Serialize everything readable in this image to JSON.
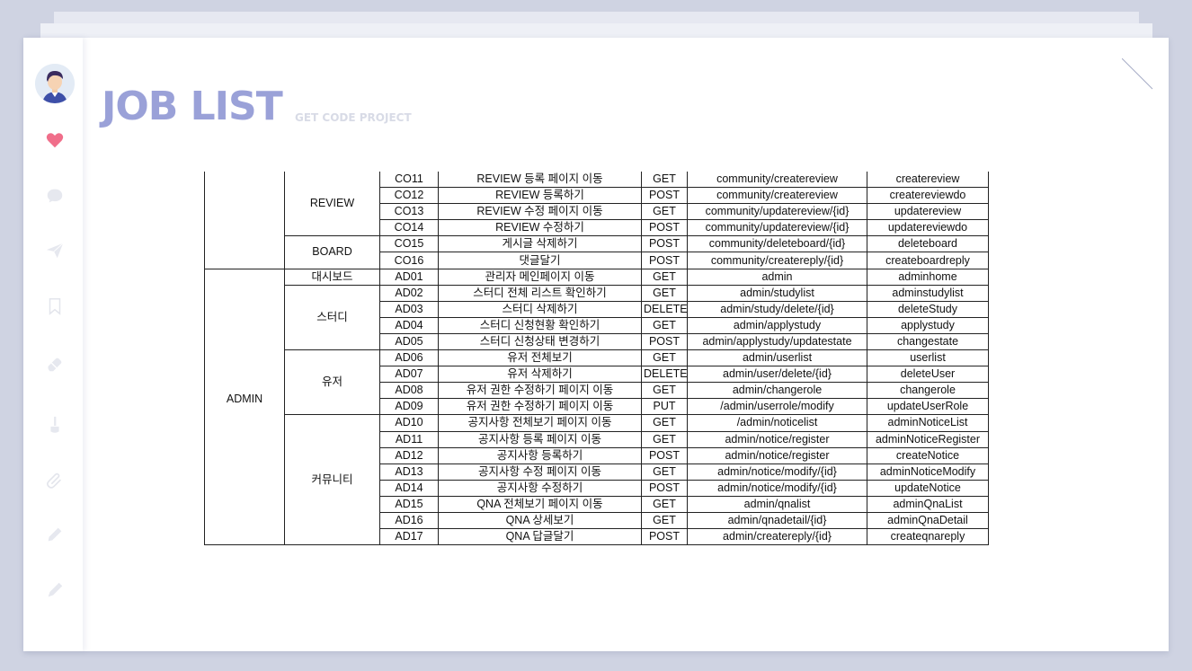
{
  "header": {
    "title": "JOB LIST",
    "subtitle": "GET CODE PROJECT"
  },
  "sidebar": {
    "icons": [
      "avatar",
      "heart-icon",
      "chat-bubble-icon",
      "paper-plane-icon",
      "bookmark-icon",
      "eraser-icon",
      "brush-icon",
      "paperclip-icon",
      "pencil-icon",
      "pen-icon"
    ],
    "accent": "#f06e8a"
  },
  "colors": {
    "title": "#9aa1d8",
    "subtitle": "#d8dbe6",
    "background": "#cfd3e2"
  },
  "table": {
    "groups": [
      {
        "category": "",
        "subgroups": [
          {
            "name": "REVIEW",
            "rows": [
              [
                "CO11",
                "REVIEW 등록 페이지 이동",
                "GET",
                "community/createreview",
                "createreview"
              ],
              [
                "CO12",
                "REVIEW 등록하기",
                "POST",
                "community/createreview",
                "createreviewdo"
              ],
              [
                "CO13",
                "REVIEW 수정 페이지 이동",
                "GET",
                "community/updatereview/{id}",
                "updatereview"
              ],
              [
                "CO14",
                "REVIEW 수정하기",
                "POST",
                "community/updatereview/{id}",
                "updatereviewdo"
              ]
            ]
          },
          {
            "name": "BOARD",
            "rows": [
              [
                "CO15",
                "게시글 삭제하기",
                "POST",
                "community/deleteboard/{id}",
                "deleteboard"
              ],
              [
                "CO16",
                "댓글달기",
                "POST",
                "community/createreply/{id}",
                "createboardreply"
              ]
            ]
          }
        ]
      },
      {
        "category": "ADMIN",
        "subgroups": [
          {
            "name": "대시보드",
            "rows": [
              [
                "AD01",
                "관리자 메인페이지 이동",
                "GET",
                "admin",
                "adminhome"
              ]
            ]
          },
          {
            "name": "스터디",
            "rows": [
              [
                "AD02",
                "스터디 전체 리스트 확인하기",
                "GET",
                "admin/studylist",
                "adminstudylist"
              ],
              [
                "AD03",
                "스터디 삭제하기",
                "DELETE",
                "admin/study/delete/{id}",
                "deleteStudy"
              ],
              [
                "AD04",
                "스터디 신청현황 확인하기",
                "GET",
                "admin/applystudy",
                "applystudy"
              ],
              [
                "AD05",
                "스터디 신청상태 변경하기",
                "POST",
                "admin/applystudy/updatestate",
                "changestate"
              ]
            ]
          },
          {
            "name": "유저",
            "rows": [
              [
                "AD06",
                "유저 전체보기",
                "GET",
                "admin/userlist",
                "userlist"
              ],
              [
                "AD07",
                "유저 삭제하기",
                "DELETE",
                "admin/user/delete/{id}",
                "deleteUser"
              ],
              [
                "AD08",
                "유저 권한 수정하기 페이지 이동",
                "GET",
                "admin/changerole",
                "changerole"
              ],
              [
                "AD09",
                "유저 권한 수정하기 페이지 이동",
                "PUT",
                "/admin/userrole/modify",
                "updateUserRole"
              ]
            ]
          },
          {
            "name": "커뮤니티",
            "rows": [
              [
                "AD10",
                "공지사항 전체보기 페이지 이동",
                "GET",
                "/admin/noticelist",
                "adminNoticeList"
              ],
              [
                "AD11",
                "공지사항 등록 페이지 이동",
                "GET",
                "admin/notice/register",
                "adminNoticeRegister"
              ],
              [
                "AD12",
                "공지사항 등록하기",
                "POST",
                "admin/notice/register",
                "createNotice"
              ],
              [
                "AD13",
                "공지사항 수정 페이지 이동",
                "GET",
                "admin/notice/modify/{id}",
                "adminNoticeModify"
              ],
              [
                "AD14",
                "공지사항 수정하기",
                "POST",
                "admin/notice/modify/{id}",
                "updateNotice"
              ],
              [
                "AD15",
                "QNA 전체보기 페이지 이동",
                "GET",
                "admin/qnalist",
                "adminQnaList"
              ],
              [
                "AD16",
                "QNA 상세보기",
                "GET",
                "admin/qnadetail/{id}",
                "adminQnaDetail"
              ],
              [
                "AD17",
                "QNA 답글달기",
                "POST",
                "admin/createreply/{id}",
                "createqnareply"
              ]
            ]
          }
        ]
      }
    ]
  }
}
